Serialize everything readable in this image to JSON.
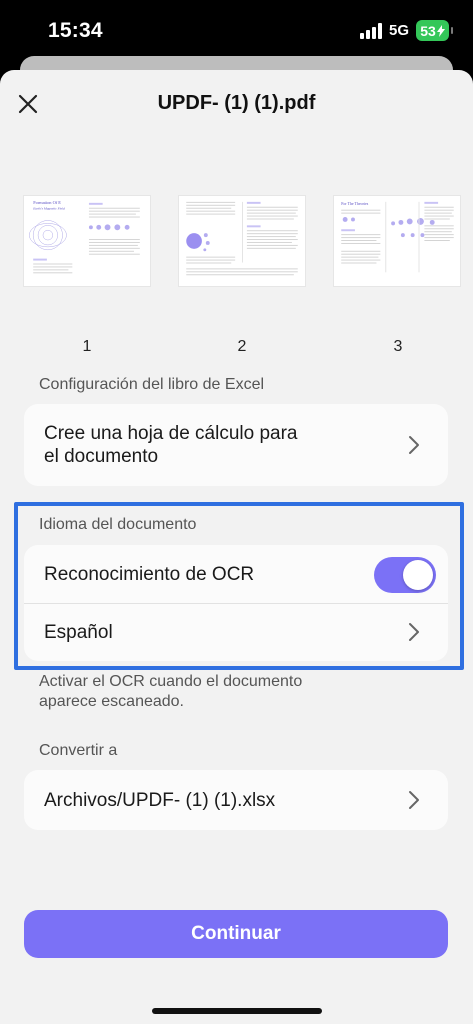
{
  "status_bar": {
    "time": "15:34",
    "network": "5G",
    "battery": "53",
    "icons": [
      "signal-icon",
      "battery-charging-icon"
    ]
  },
  "header": {
    "title": "UPDF- (1) (1).pdf",
    "close_icon": "close-icon"
  },
  "thumbnails": {
    "pages": [
      {
        "number": "1",
        "heading": "Formation Of E",
        "subheading": "Earth's Magnetic Field"
      },
      {
        "number": "2",
        "heading": "",
        "subheading": ""
      },
      {
        "number": "3",
        "heading": "For The Theories",
        "subheading": ""
      }
    ]
  },
  "excel_section": {
    "label": "Configuración del libro de Excel",
    "option_line1": "Cree una hoja de cálculo para",
    "option_line2": "el documento"
  },
  "language_section": {
    "label": "Idioma del documento",
    "ocr_label": "Reconocimiento de OCR",
    "ocr_enabled": true,
    "language_value": "Español",
    "help_line1": "Activar el OCR cuando el documento",
    "help_line2": "aparece escaneado."
  },
  "convert_section": {
    "label": "Convertir a",
    "path": "Archivos/UPDF- (1) (1).xlsx"
  },
  "footer": {
    "continue_label": "Continuar"
  },
  "colors": {
    "accent": "#7b71f6",
    "highlight_border": "#2f6fe0",
    "battery": "#34c759",
    "sheet_background": "#f2f2f2"
  }
}
